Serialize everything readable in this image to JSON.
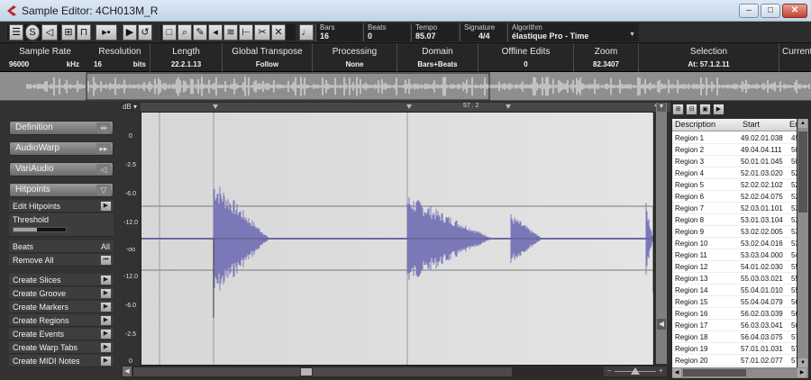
{
  "window": {
    "title": "Sample Editor: 4CH013M_R",
    "minimize_glyph": "‒",
    "maximize_glyph": "□",
    "close_glyph": "✕"
  },
  "toolbar": {
    "fields": [
      {
        "label": "Bars",
        "value": "16"
      },
      {
        "label": "Beats",
        "value": "0"
      },
      {
        "label": "Tempo",
        "value": "85.07"
      },
      {
        "label": "Signature",
        "value": "4/4"
      },
      {
        "label": "Algorithm",
        "value": "élastique Pro - Time"
      }
    ]
  },
  "info": [
    {
      "label": "Sample Rate",
      "value": "96000",
      "unit": "kHz"
    },
    {
      "label": "Resolution",
      "value": "16",
      "unit": "bits"
    },
    {
      "label": "Length",
      "value": "22.2.1.13"
    },
    {
      "label": "Global Transpose",
      "value": "Follow"
    },
    {
      "label": "Processing",
      "value": "None"
    },
    {
      "label": "Domain",
      "value": "Bars+Beats"
    },
    {
      "label": "Offline Edits",
      "value": "0"
    },
    {
      "label": "Zoom",
      "value": "82.3407"
    },
    {
      "label": "Selection",
      "value": "At: 57.1.2.11"
    },
    {
      "label": "Current",
      "value": ""
    }
  ],
  "left_panel": {
    "tabs": [
      "Definition",
      "AudioWarp",
      "VariAudio",
      "Hitpoints"
    ],
    "hitpoints": {
      "edit_label": "Edit Hitpoints",
      "threshold_label": "Threshold",
      "beats_label": "Beats",
      "beats_value": "All",
      "remove_all_label": "Remove All"
    },
    "create_actions": [
      "Create Slices",
      "Create Groove",
      "Create Markers",
      "Create Regions",
      "Create Events",
      "Create Warp Tabs",
      "Create MIDI Notes"
    ]
  },
  "waveform": {
    "db_label": "dB",
    "db_ticks": [
      "0",
      "-2.5",
      "-6.0",
      "-12.0",
      "-oo",
      "-12.0",
      "-6.0",
      "-2.5",
      "0"
    ],
    "ruler_marker": "57 . 2",
    "wave_color": "#7b78b8"
  },
  "regions": {
    "headers": {
      "description": "Description",
      "start": "Start",
      "end": "End"
    },
    "rows": [
      {
        "description": "Region 1",
        "start": "49.02.01.038",
        "end": "49"
      },
      {
        "description": "Region 2",
        "start": "49.04.04.111",
        "end": "50"
      },
      {
        "description": "Region 3",
        "start": "50.01.01.045",
        "end": "50"
      },
      {
        "description": "Region 4",
        "start": "52.01.03.020",
        "end": "52"
      },
      {
        "description": "Region 5",
        "start": "52.02.02.102",
        "end": "52"
      },
      {
        "description": "Region 6",
        "start": "52.02.04.075",
        "end": "52"
      },
      {
        "description": "Region 7",
        "start": "52.03.01.101",
        "end": "53"
      },
      {
        "description": "Region 8",
        "start": "53.01.03.104",
        "end": "53"
      },
      {
        "description": "Region 9",
        "start": "53.02.02.005",
        "end": "53"
      },
      {
        "description": "Region 10",
        "start": "53.02.04.016",
        "end": "53"
      },
      {
        "description": "Region 11",
        "start": "53.03.04.000",
        "end": "54"
      },
      {
        "description": "Region 12",
        "start": "54.01.02.030",
        "end": "55"
      },
      {
        "description": "Region 13",
        "start": "55.03.03.021",
        "end": "55"
      },
      {
        "description": "Region 14",
        "start": "55.04.01.010",
        "end": "55"
      },
      {
        "description": "Region 15",
        "start": "55.04.04.079",
        "end": "56"
      },
      {
        "description": "Region 16",
        "start": "56.02.03.039",
        "end": "56"
      },
      {
        "description": "Region 17",
        "start": "56.03.03.041",
        "end": "56"
      },
      {
        "description": "Region 18",
        "start": "56.04.03.075",
        "end": "57"
      },
      {
        "description": "Region 19",
        "start": "57.01.01.031",
        "end": "57"
      },
      {
        "description": "Region 20",
        "start": "57.01.02.077",
        "end": "57"
      }
    ]
  }
}
